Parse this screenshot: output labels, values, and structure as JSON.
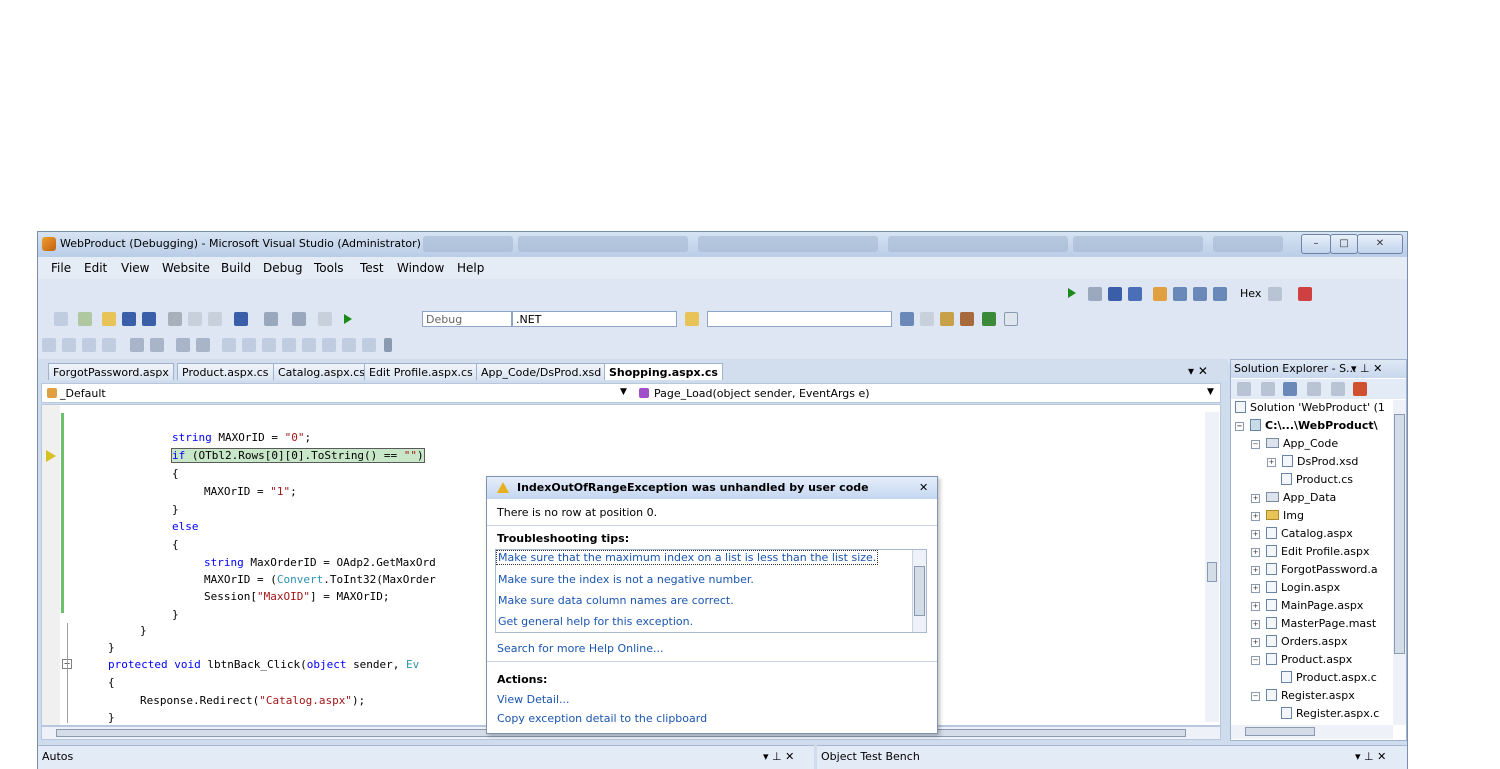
{
  "window": {
    "title": "WebProduct (Debugging) - Microsoft Visual Studio (Administrator)",
    "min_label": "–",
    "max_label": "□",
    "close_label": "✕"
  },
  "menu": [
    "File",
    "Edit",
    "View",
    "Website",
    "Build",
    "Debug",
    "Tools",
    "Test",
    "Window",
    "Help"
  ],
  "toolbar": {
    "config_value": "Debug",
    "platform_value": ".NET",
    "hex_label": "Hex"
  },
  "tabs": [
    {
      "label": "ForgotPassword.aspx",
      "active": false
    },
    {
      "label": "Product.aspx.cs",
      "active": false
    },
    {
      "label": "Catalog.aspx.cs",
      "active": false
    },
    {
      "label": "Edit Profile.aspx.cs",
      "active": false
    },
    {
      "label": "App_Code/DsProd.xsd",
      "active": false
    },
    {
      "label": "Shopping.aspx.cs",
      "active": true
    }
  ],
  "tab_close_label": "▾ ✕",
  "editor": {
    "class_combo": "_Default",
    "method_combo": "Page_Load(object sender, EventArgs e)"
  },
  "code": {
    "l1a": "string ",
    "l1b": "MAXOrID = ",
    "l1c": "\"0\"",
    "l1d": ";",
    "l2a": "if",
    "l2b": " (OTbl2.Rows[0][0].ToString() == ",
    "l2c": "\"\"",
    "l2d": ")",
    "l3": "{",
    "l4a": "MAXOrID = ",
    "l4b": "\"1\"",
    "l4c": ";",
    "l5": "}",
    "l6": "else",
    "l7": "{",
    "l8a": "string ",
    "l8b": "MaxOrderID = OAdp2.GetMaxOrd",
    "l9a": "MAXOrID = (",
    "l9b": "Convert",
    "l9c": ".ToInt32(MaxOrder",
    "l10a": "Session[",
    "l10b": "\"MaxOID\"",
    "l10c": "] = MAXOrID;",
    "l11": "}",
    "l12": "}",
    "l13": "}",
    "l14a": "protected ",
    "l14b": "void ",
    "l14c": "lbtnBack_Click(",
    "l14d": "object ",
    "l14e": "sender, ",
    "l14f": "Ev",
    "l15": "{",
    "l16a": "Response.Redirect(",
    "l16b": "\"Catalog.aspx\"",
    "l16c": ");",
    "l17": "}"
  },
  "exception": {
    "title": "IndexOutOfRangeException was unhandled by user code",
    "close": "✕",
    "message": "There is no row at position 0.",
    "tips_header": "Troubleshooting tips:",
    "tips": [
      "Make sure that the maximum index on a list is less than the list size.",
      "Make sure the index is not a negative number.",
      "Make sure data column names are correct.",
      "Get general help for this exception."
    ],
    "search_link": "Search for more Help Online...",
    "actions_header": "Actions:",
    "actions": [
      "View Detail...",
      "Copy exception detail to the clipboard"
    ]
  },
  "solution_explorer": {
    "title": "Solution Explorer - S...",
    "controls": "▾ ⊥ ✕",
    "nodes": [
      {
        "label": "Solution 'WebProduct' (1",
        "indent": 0,
        "type": "solution",
        "bold": false
      },
      {
        "label": "C:\\...\\WebProduct\\",
        "indent": 1,
        "type": "project",
        "bold": true
      },
      {
        "label": "App_Code",
        "indent": 2,
        "type": "folder",
        "bold": false
      },
      {
        "label": "DsProd.xsd",
        "indent": 3,
        "type": "file",
        "bold": false
      },
      {
        "label": "Product.cs",
        "indent": 3,
        "type": "file",
        "bold": false
      },
      {
        "label": "App_Data",
        "indent": 2,
        "type": "folder",
        "bold": false
      },
      {
        "label": "Img",
        "indent": 2,
        "type": "folder",
        "bold": false
      },
      {
        "label": "Catalog.aspx",
        "indent": 2,
        "type": "file",
        "bold": false
      },
      {
        "label": "Edit Profile.aspx",
        "indent": 2,
        "type": "file",
        "bold": false
      },
      {
        "label": "ForgotPassword.a",
        "indent": 2,
        "type": "file",
        "bold": false
      },
      {
        "label": "Login.aspx",
        "indent": 2,
        "type": "file",
        "bold": false
      },
      {
        "label": "MainPage.aspx",
        "indent": 2,
        "type": "file",
        "bold": false
      },
      {
        "label": "MasterPage.mast",
        "indent": 2,
        "type": "file",
        "bold": false
      },
      {
        "label": "Orders.aspx",
        "indent": 2,
        "type": "file",
        "bold": false
      },
      {
        "label": "Product.aspx",
        "indent": 2,
        "type": "file",
        "bold": false
      },
      {
        "label": "Product.aspx.c",
        "indent": 3,
        "type": "file",
        "bold": false
      },
      {
        "label": "Register.aspx",
        "indent": 2,
        "type": "file",
        "bold": false
      },
      {
        "label": "Register.aspx.c",
        "indent": 3,
        "type": "file",
        "bold": false
      }
    ]
  },
  "panes": {
    "autos": "Autos",
    "otb": "Object Test Bench",
    "controls": "▾ ⊥ ✕"
  },
  "colors": {
    "keyword": "#0000ff",
    "type": "#2b91af",
    "string": "#a31515",
    "link": "#1a55b0",
    "highlight": "#c8e6c8"
  }
}
